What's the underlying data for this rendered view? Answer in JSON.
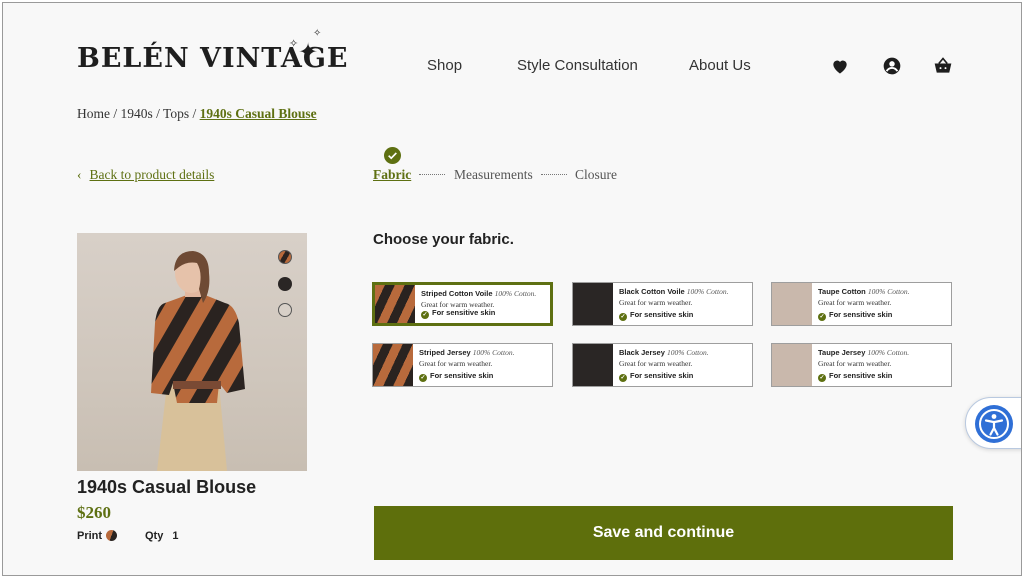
{
  "brand": {
    "name": "BELÉN VINTAGE"
  },
  "nav": {
    "items": [
      "Shop",
      "Style Consultation",
      "About Us"
    ]
  },
  "header_icons": [
    "heart-icon",
    "account-icon",
    "basket-icon"
  ],
  "breadcrumb": {
    "items": [
      "Home",
      "1940s",
      "Tops"
    ],
    "current": "1940s Casual Blouse"
  },
  "back_link": {
    "label": "Back to product details"
  },
  "steps": [
    {
      "label": "Fabric",
      "active": true,
      "completed": true
    },
    {
      "label": "Measurements",
      "active": false
    },
    {
      "label": "Closure",
      "active": false
    }
  ],
  "product": {
    "title": "1940s Casual Blouse",
    "price": "$260",
    "print_label": "Print",
    "qty_label": "Qty",
    "qty": "1"
  },
  "section_title": "Choose your fabric.",
  "fabrics": [
    {
      "name": "Striped Cotton Voile",
      "composition": "100% Cotton.",
      "desc": "Great for warm weather.",
      "tag": "For sensitive skin",
      "swatch": "striped",
      "selected": true
    },
    {
      "name": "Black Cotton Voile",
      "composition": "100% Cotton.",
      "desc": "Great for warm weather.",
      "tag": "For sensitive skin",
      "swatch": "black",
      "selected": false
    },
    {
      "name": "Taupe Cotton",
      "composition": "100% Cotton.",
      "desc": "Great for warm weather.",
      "tag": "For sensitive skin",
      "swatch": "taupe",
      "selected": false
    },
    {
      "name": "Striped Jersey",
      "composition": "100% Cotton.",
      "desc": "Great for warm weather.",
      "tag": "For sensitive skin",
      "swatch": "striped",
      "selected": false
    },
    {
      "name": "Black Jersey",
      "composition": "100% Cotton.",
      "desc": "Great for warm weather.",
      "tag": "For sensitive skin",
      "swatch": "black",
      "selected": false
    },
    {
      "name": "Taupe Jersey",
      "composition": "100% Cotton.",
      "desc": "Great for warm weather.",
      "tag": "For sensitive skin",
      "swatch": "taupe",
      "selected": false
    }
  ],
  "cta": {
    "label": "Save and continue"
  },
  "colors": {
    "accent": "#5e7012",
    "button": "#5e6f0c",
    "a11y": "#2f6fd6"
  }
}
